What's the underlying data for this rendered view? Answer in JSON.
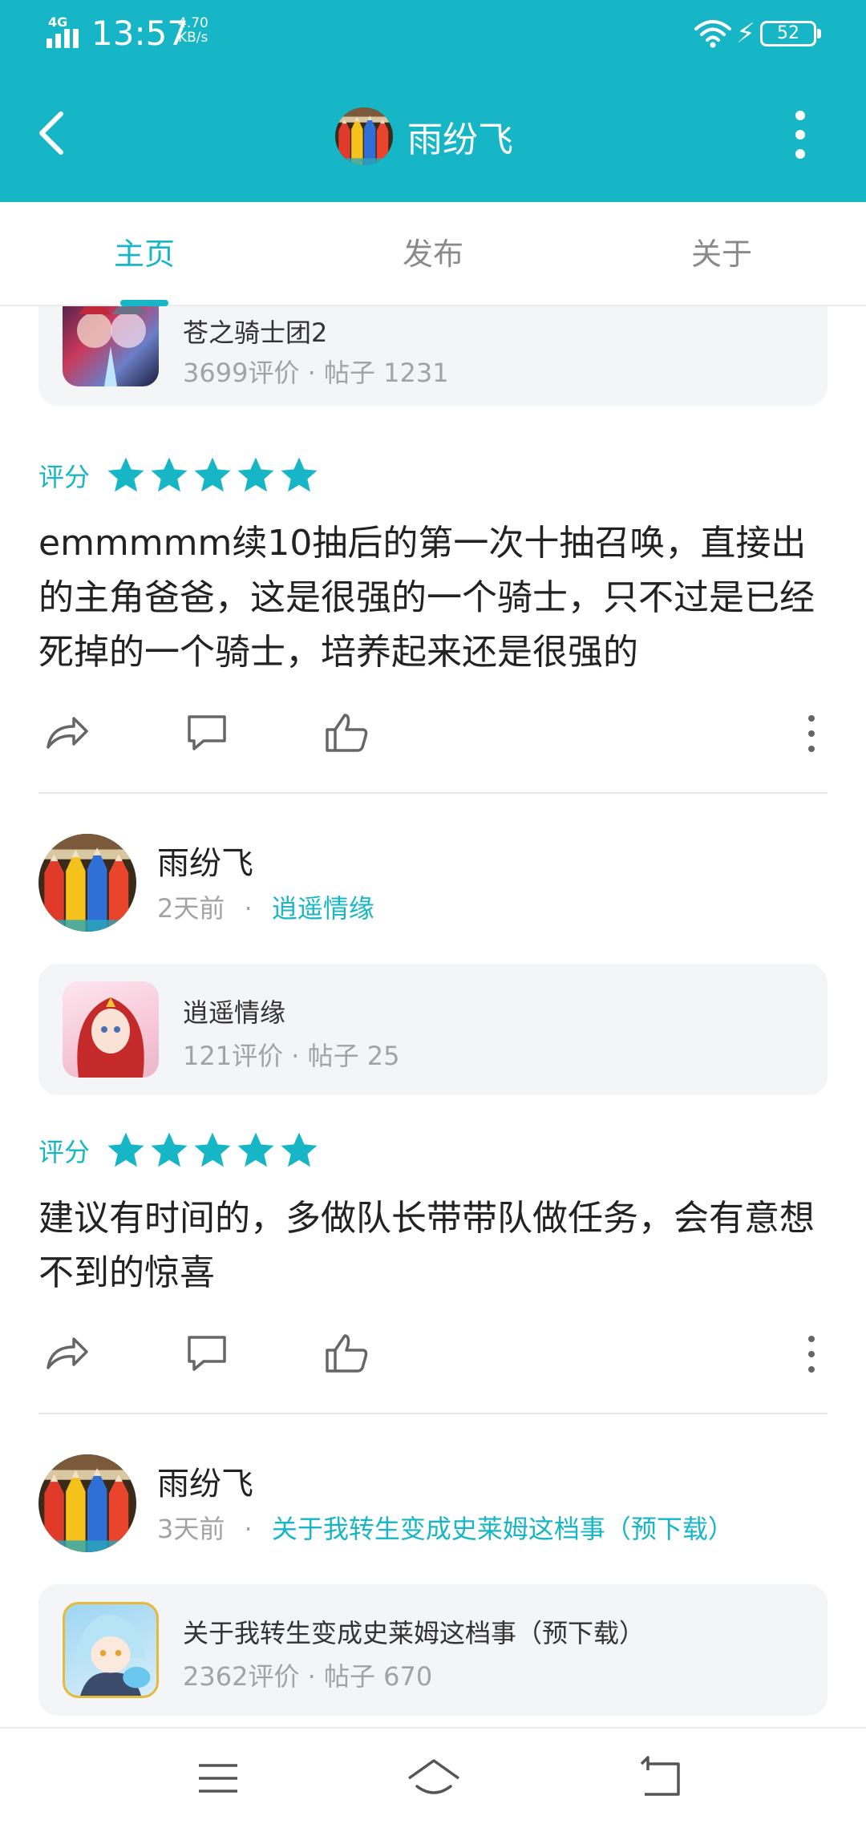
{
  "status_bar": {
    "network": "4G",
    "time": "13:57",
    "speed_value": "4.70",
    "speed_unit": "KB/s",
    "battery": "52"
  },
  "app_bar": {
    "title": "雨纷飞",
    "icons": [
      "back-arrow-icon",
      "pencils-avatar",
      "more-vertical-icon"
    ]
  },
  "tabs": [
    {
      "label": "主页",
      "active": true
    },
    {
      "label": "发布",
      "active": false
    },
    {
      "label": "关于",
      "active": false
    }
  ],
  "colors": {
    "accent": "#17b6c6",
    "card_bg": "#f4f5f7",
    "muted": "#a3a3a3"
  },
  "posts": [
    {
      "game": {
        "name": "苍之骑士团2",
        "reviews": "3699评价",
        "posts": "帖子 1231"
      },
      "rating_label": "评分",
      "stars": 5,
      "text": "emmmmm续10抽后的第一次十抽召唤，直接出的主角爸爸，这是很强的一个骑士，只不过是已经死掉的一个骑士，培养起来还是很强的"
    },
    {
      "author": {
        "name": "雨纷飞",
        "time": "2天前",
        "game_link": "逍遥情缘"
      },
      "game": {
        "name": "逍遥情缘",
        "reviews": "121评价",
        "posts": "帖子 25"
      },
      "rating_label": "评分",
      "stars": 5,
      "text": "建议有时间的，多做队长带带队做任务，会有意想不到的惊喜"
    },
    {
      "author": {
        "name": "雨纷飞",
        "time": "3天前",
        "game_link": "关于我转生变成史莱姆这档事（预下载）"
      },
      "game": {
        "name": "关于我转生变成史莱姆这档事（预下载）",
        "reviews": "2362评价",
        "posts": "帖子 670"
      }
    }
  ],
  "meta_separator": "·",
  "nav_icons": [
    "menu-icon",
    "home-icon",
    "back-icon"
  ]
}
